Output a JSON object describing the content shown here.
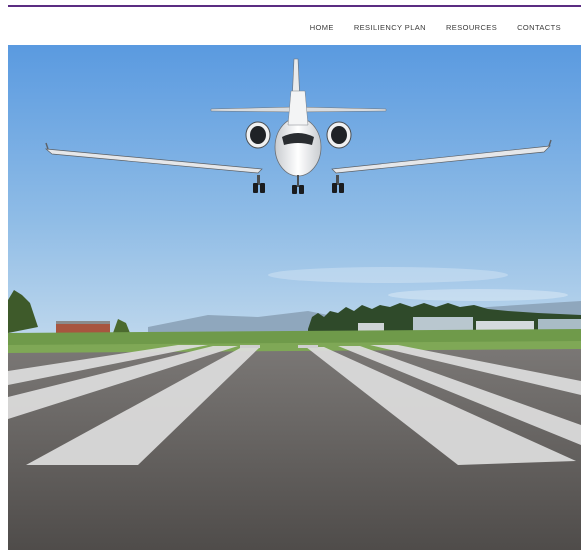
{
  "nav": {
    "items": [
      {
        "label": "HOME"
      },
      {
        "label": "RESILIENCY PLAN"
      },
      {
        "label": "RESOURCES"
      },
      {
        "label": "CONTACTS"
      }
    ]
  },
  "theme": {
    "accent": "#5b2d82",
    "nav_text": "#3a3a3a",
    "sky_top": "#5a9ae0",
    "sky_bottom": "#bcd6ec",
    "grass": "#6f9a4a",
    "tarmac": "#5b5856",
    "stripe": "#dedede"
  },
  "hero": {
    "icons": [
      "jet-airplane-icon",
      "runway-image"
    ]
  }
}
